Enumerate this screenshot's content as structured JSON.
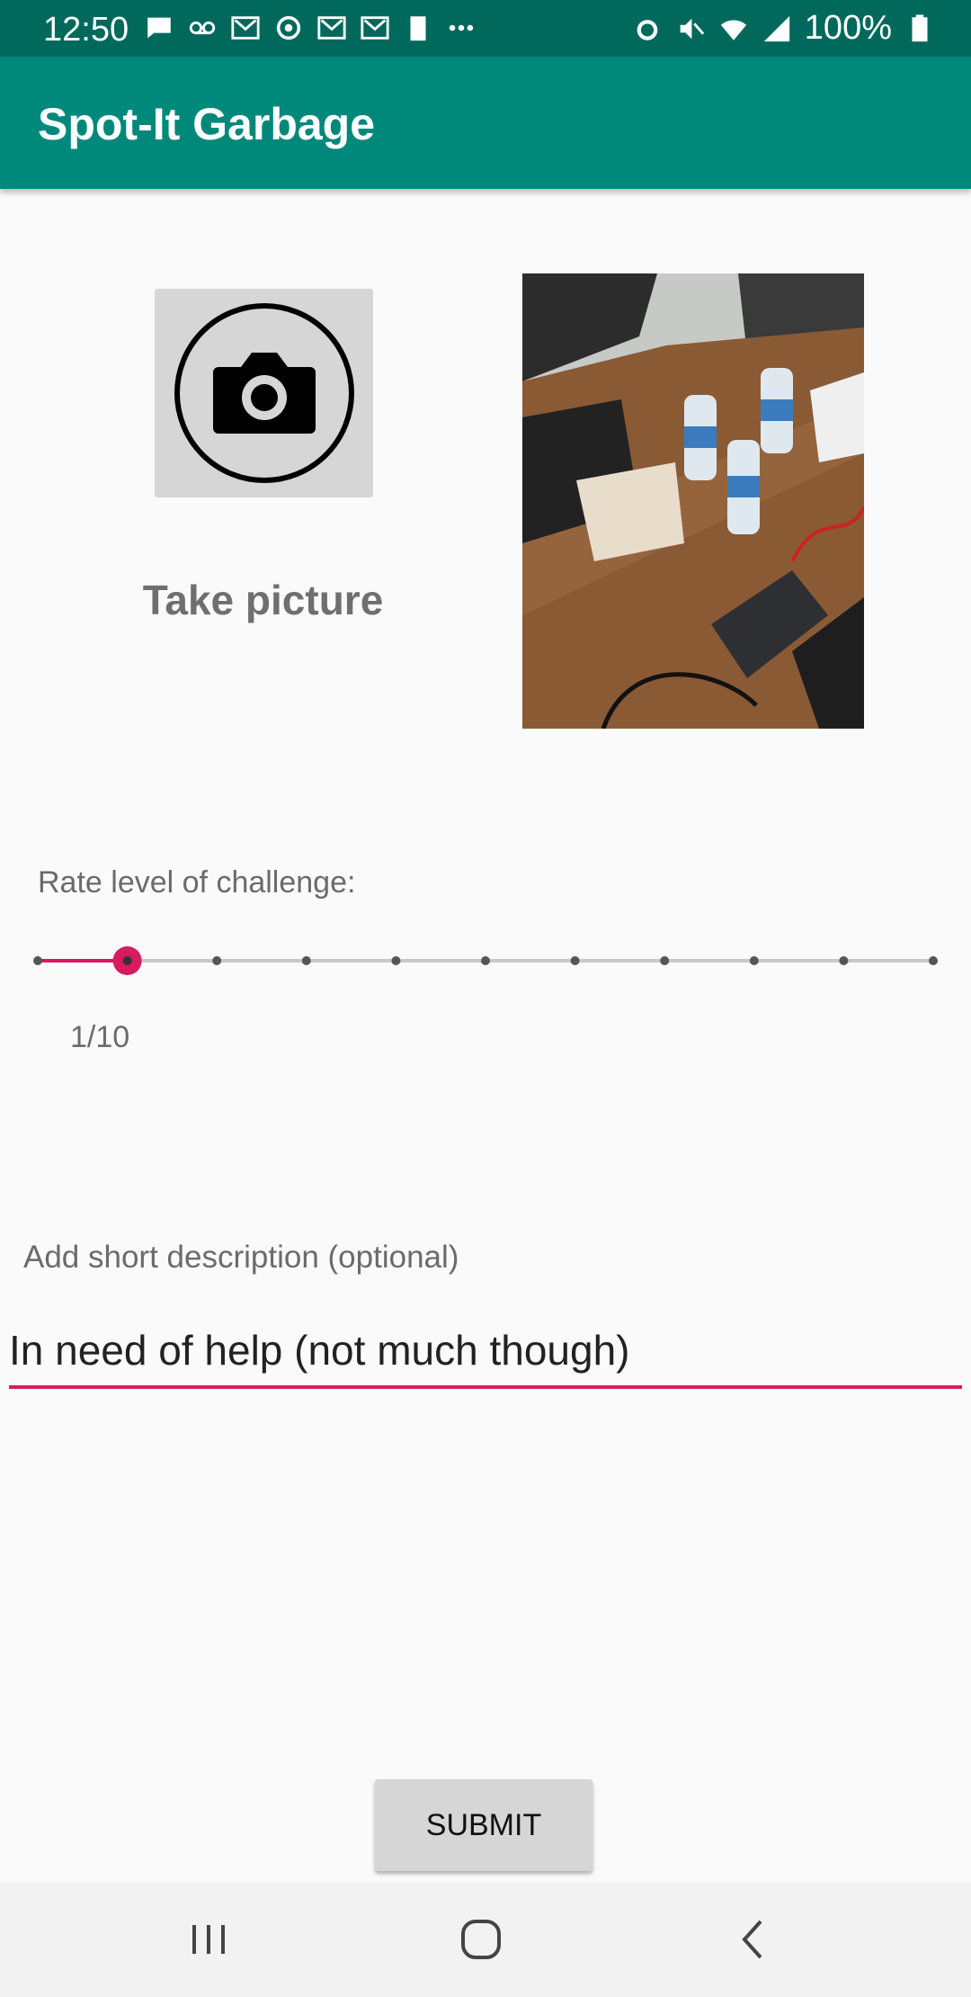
{
  "status_bar": {
    "time": "12:50",
    "battery_percent": "100%",
    "icons": [
      "message-icon",
      "voicemail-icon",
      "gmail-icon",
      "sync-icon",
      "gmail-icon",
      "gmail-icon",
      "battery-full-icon",
      "more-icon",
      "alarm-icon",
      "mute-icon",
      "wifi-icon",
      "signal-icon",
      "battery-icon"
    ]
  },
  "app_bar": {
    "title": "Spot-It Garbage"
  },
  "camera": {
    "take_picture_label": "Take picture"
  },
  "rating": {
    "label": "Rate level of challenge:",
    "value_text": "1/10",
    "value": 1,
    "max": 10,
    "accent_color": "#d81b60"
  },
  "description": {
    "label": "Add short description (optional)",
    "value": "In need of help (not much though)"
  },
  "submit": {
    "label": "SUBMIT"
  },
  "colors": {
    "status_bar": "#00695c",
    "app_bar": "#00897b",
    "accent": "#d81b60"
  }
}
